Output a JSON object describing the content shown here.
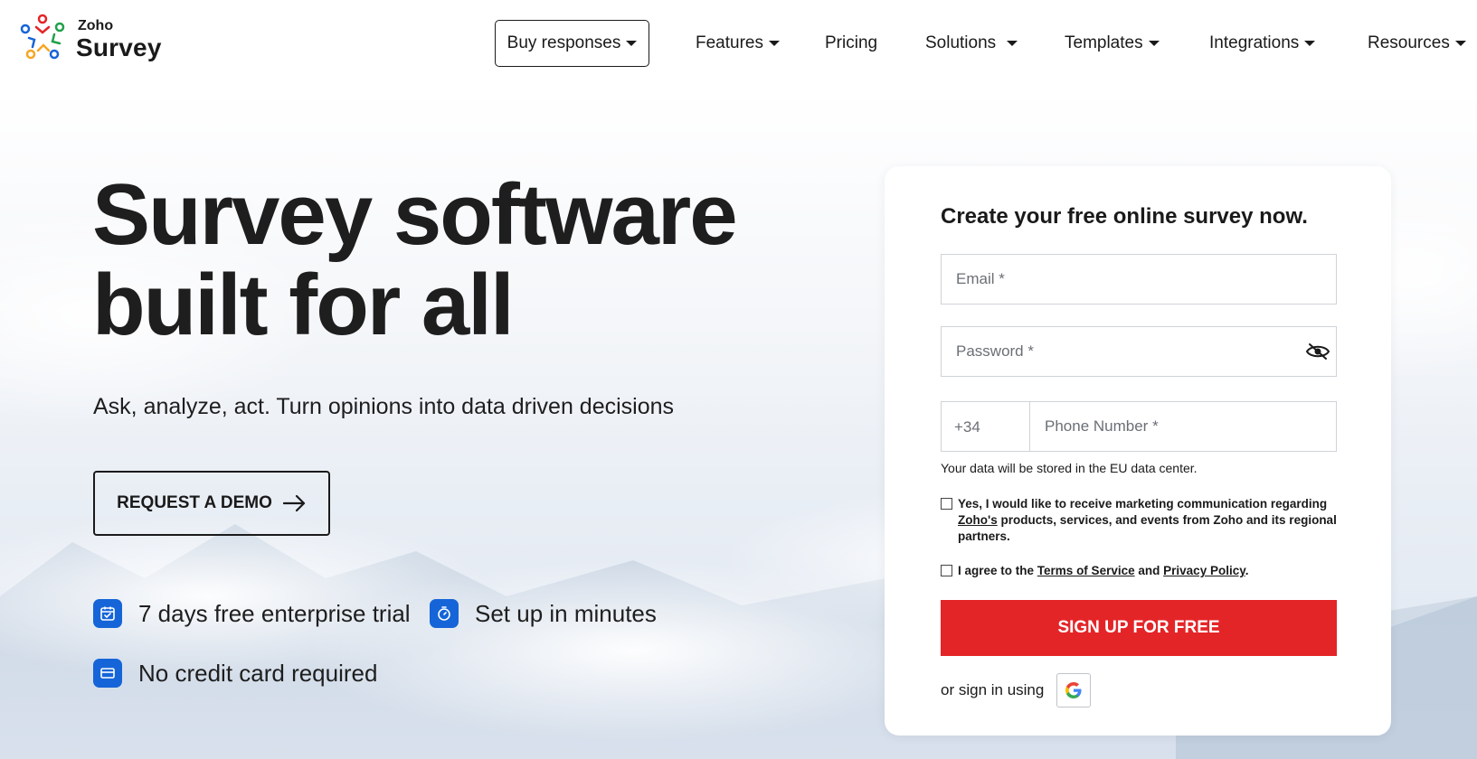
{
  "header": {
    "logo_top": "Zoho",
    "logo_bottom": "Survey",
    "nav": {
      "buy_responses": "Buy responses",
      "features": "Features",
      "pricing": "Pricing",
      "solutions": "Solutions",
      "templates": "Templates",
      "integrations": "Integrations",
      "resources": "Resources"
    }
  },
  "hero": {
    "title_line1": "Survey software",
    "title_line2": "built for all",
    "subtitle": "Ask, analyze, act. Turn opinions into data driven decisions",
    "demo_button": "REQUEST A DEMO",
    "features": [
      {
        "text": "7 days free enterprise trial",
        "icon": "calendar-check-icon"
      },
      {
        "text": "Set up in minutes",
        "icon": "stopwatch-icon"
      },
      {
        "text": "No credit card required",
        "icon": "credit-card-icon"
      }
    ]
  },
  "signup": {
    "title": "Create your free online survey now.",
    "email_placeholder": "Email *",
    "password_placeholder": "Password *",
    "country_code": "+34",
    "phone_placeholder": "Phone Number *",
    "data_note": "Your data will be stored in the EU data center.",
    "marketing": {
      "before": "Yes, I would like to receive marketing communication regarding",
      "link": "Zoho's",
      "after": "products, services, and events from Zoho and its regional partners."
    },
    "agree": {
      "before": "I agree to the",
      "terms": "Terms of Service",
      "and": "and",
      "privacy": "Privacy Policy",
      "end": "."
    },
    "button": "SIGN UP FOR FREE",
    "or_sign_in": "or sign in using"
  },
  "colors": {
    "accent_red": "#e42528",
    "badge_blue": "#1565d8",
    "text_dark": "#1a1a1a"
  }
}
